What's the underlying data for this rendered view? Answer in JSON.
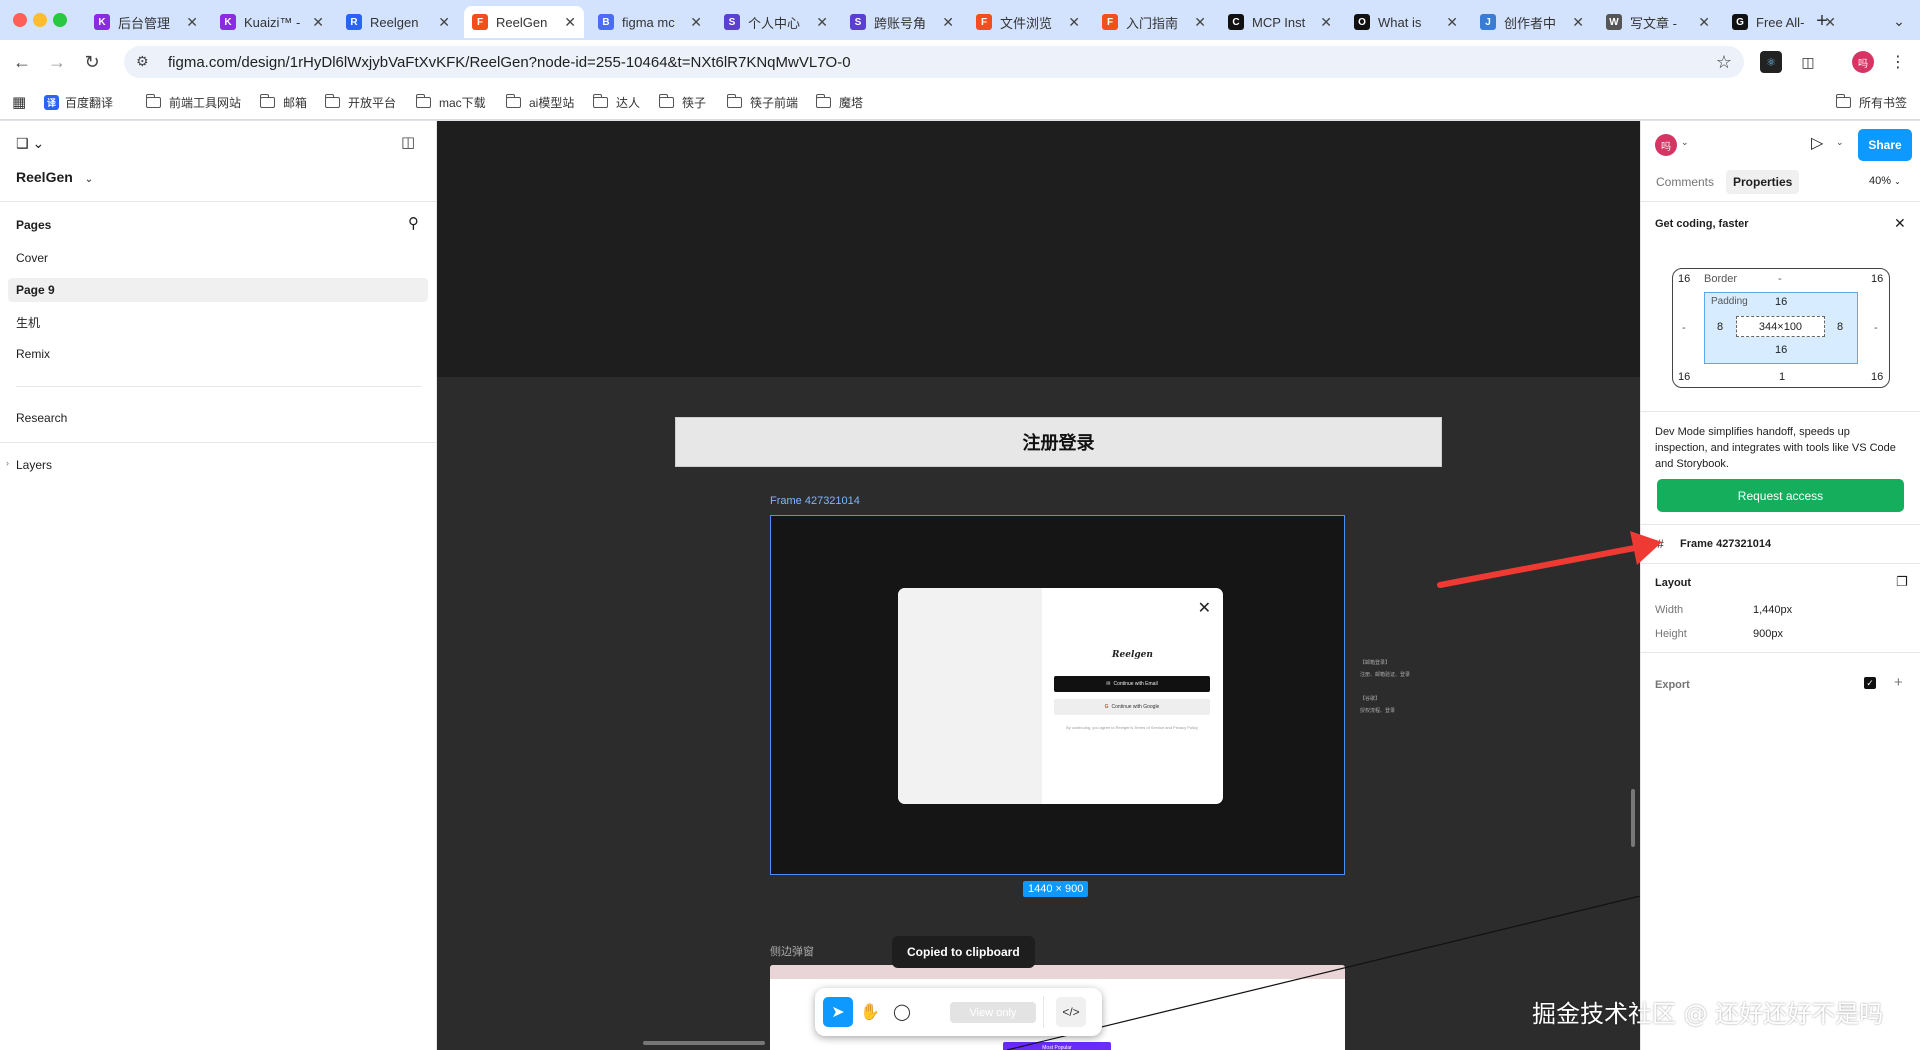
{
  "browser": {
    "tabs": [
      {
        "label": "后台管理",
        "color": "#8a2be2",
        "glyph": "K"
      },
      {
        "label": "Kuaizi™ -",
        "color": "#8a2be2",
        "glyph": "K"
      },
      {
        "label": "Reelgen",
        "color": "#2c62f6",
        "glyph": "R"
      },
      {
        "label": "ReelGen",
        "color": "#f24e1e",
        "glyph": "F",
        "active": true
      },
      {
        "label": "figma mc",
        "color": "#4a6cf7",
        "glyph": "B"
      },
      {
        "label": "个人中心",
        "color": "#5b3fd1",
        "glyph": "S"
      },
      {
        "label": "跨账号角",
        "color": "#5b3fd1",
        "glyph": "S"
      },
      {
        "label": "文件浏览",
        "color": "#f24e1e",
        "glyph": "F"
      },
      {
        "label": "入门指南",
        "color": "#f24e1e",
        "glyph": "F"
      },
      {
        "label": "MCP Inst",
        "color": "#111111",
        "glyph": "C"
      },
      {
        "label": "What is",
        "color": "#111111",
        "glyph": "O"
      },
      {
        "label": "创作者中",
        "color": "#3a7bd5",
        "glyph": "J"
      },
      {
        "label": "写文章 -",
        "color": "#555555",
        "glyph": "W"
      },
      {
        "label": "Free All-",
        "color": "#111111",
        "glyph": "G"
      }
    ],
    "url": "figma.com/design/1rHyDl6lWxjybVaFtXvKFK/ReelGen?node-id=255-10464&t=NXt6lR7KNqMwVL7O-0",
    "profile_initial": "吗",
    "bookmarks": [
      {
        "label": "百度翻译",
        "type": "app"
      },
      {
        "label": "前端工具网站",
        "type": "folder"
      },
      {
        "label": "邮箱",
        "type": "folder"
      },
      {
        "label": "开放平台",
        "type": "folder"
      },
      {
        "label": "mac下载",
        "type": "folder"
      },
      {
        "label": "ai模型站",
        "type": "folder"
      },
      {
        "label": "达人",
        "type": "folder"
      },
      {
        "label": "筷子",
        "type": "folder"
      },
      {
        "label": "筷子前端",
        "type": "folder"
      },
      {
        "label": "魔塔",
        "type": "folder"
      }
    ],
    "all_bookmarks": "所有书签"
  },
  "left_panel": {
    "file_name": "ReelGen",
    "pages_heading": "Pages",
    "pages": [
      "Cover",
      "Page 9",
      "生机",
      "Remix"
    ],
    "selected_page": "Page 9",
    "extra_page": "Research",
    "layers_heading": "Layers"
  },
  "canvas": {
    "banner_title": "注册登录",
    "frame_name": "Frame 427321014",
    "frame_size": "1440 × 900",
    "modal": {
      "logo": "Reelgen",
      "email_button": "Continue with Email",
      "google_button": "Continue with Google",
      "terms": "By continuing, you agree to Reelgen's Terms of Service and Privacy Policy"
    },
    "side_notes": [
      "【邮箱登录】",
      "注册、邮箱验证、登录",
      "",
      "【谷歌】",
      "授权流程、登录"
    ],
    "second_frame_label": "侧边弹窗",
    "toast": "Copied to clipboard",
    "view_only": "View only",
    "purple_button": "Most Popular",
    "watermark": "掘金技术社区 @ 还好还好不是吗"
  },
  "right_panel": {
    "share": "Share",
    "tabs": [
      "Comments",
      "Properties"
    ],
    "active_tab": "Properties",
    "zoom": "40%",
    "promo_title": "Get coding, faster",
    "box_model": {
      "margin_top_left": "16",
      "margin_top_right": "16",
      "margin_bottom_left": "16",
      "margin_bottom_right": "16",
      "border_label": "Border",
      "border_value": "-",
      "padding_label": "Padding",
      "padding_top": "16",
      "padding_bottom": "16",
      "padding_left": "8",
      "padding_right": "8",
      "content": "344×100",
      "side_left": "-",
      "side_right": "-",
      "bottom_center": "1"
    },
    "promo_text": "Dev Mode simplifies handoff, speeds up inspection, and integrates with tools like VS Code and Storybook.",
    "request_access": "Request access",
    "selection_name": "Frame 427321014",
    "layout_heading": "Layout",
    "width_label": "Width",
    "width_value": "1,440px",
    "height_label": "Height",
    "height_value": "900px",
    "export_heading": "Export"
  }
}
